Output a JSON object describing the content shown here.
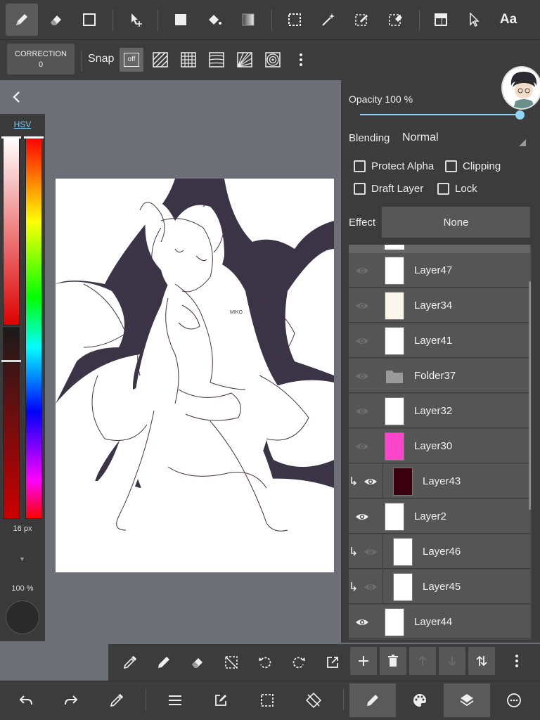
{
  "top_toolbar": {
    "tools": [
      "brush-icon",
      "eraser-icon",
      "rectangle-icon",
      "move-icon",
      "fill-rect-icon",
      "bucket-icon",
      "gradient-icon",
      "select-rect-icon",
      "magic-wand-icon",
      "select-pen-icon",
      "select-eraser-icon",
      "layer-move-icon",
      "pointer-icon",
      "text-icon"
    ],
    "text_tool_label": "Aa"
  },
  "sub_toolbar": {
    "correction_label": "CORRECTION",
    "correction_value": "0",
    "snap_label": "Snap",
    "snap_off_label": "off"
  },
  "color_panel": {
    "mode_label": "HSV",
    "brush_size": "16 px",
    "brush_opacity": "100 %",
    "colors": {
      "hue_selected": "#cc0000",
      "brush_color": "#2a2a2a"
    }
  },
  "layer_props": {
    "opacity_label": "Opacity 100 %",
    "opacity_value": 100,
    "blending_label": "Blending",
    "blending_value": "Normal",
    "protect_alpha": "Protect Alpha",
    "clipping": "Clipping",
    "draft_layer": "Draft Layer",
    "lock": "Lock",
    "effect_label": "Effect",
    "effect_value": "None"
  },
  "layers": [
    {
      "name": "Layer47",
      "visible": false,
      "clip": false,
      "thumb": "#ffffff"
    },
    {
      "name": "Layer34",
      "visible": false,
      "clip": false,
      "thumb": "#fbf6ea"
    },
    {
      "name": "Layer41",
      "visible": false,
      "clip": false,
      "thumb": "#ffffff"
    },
    {
      "name": "Folder37",
      "visible": false,
      "clip": false,
      "thumb": "folder"
    },
    {
      "name": "Layer32",
      "visible": false,
      "clip": false,
      "thumb": "#ffffff"
    },
    {
      "name": "Layer30",
      "visible": false,
      "clip": false,
      "thumb": "#ff44cc"
    },
    {
      "name": "Layer43",
      "visible": true,
      "clip": true,
      "thumb": "#3a0010"
    },
    {
      "name": "Layer2",
      "visible": true,
      "clip": false,
      "thumb": "#ffffff"
    },
    {
      "name": "Layer46",
      "visible": false,
      "clip": true,
      "thumb": "#ffffff"
    },
    {
      "name": "Layer45",
      "visible": false,
      "clip": true,
      "thumb": "#ffffff"
    },
    {
      "name": "Layer44",
      "visible": true,
      "clip": false,
      "thumb": "#ffffff"
    }
  ],
  "canvas": {
    "signature": "MIKO",
    "background_color": "#3a3446"
  },
  "mid_toolbar": [
    "eyedropper-icon",
    "pen-icon",
    "eraser-icon",
    "deselect-icon",
    "rotate-left-icon",
    "rotate-right-icon",
    "export-icon"
  ],
  "layer_toolbar": [
    "add-layer-icon",
    "delete-layer-icon",
    "move-up-icon",
    "move-down-icon",
    "swap-icon",
    "more-icon"
  ],
  "bottom_bar": [
    "undo-icon",
    "redo-icon",
    "eyedropper-icon",
    "menu-icon",
    "edit-icon",
    "selection-icon",
    "transform-icon",
    "brush-icon",
    "palette-icon",
    "layers-icon",
    "settings-icon"
  ]
}
